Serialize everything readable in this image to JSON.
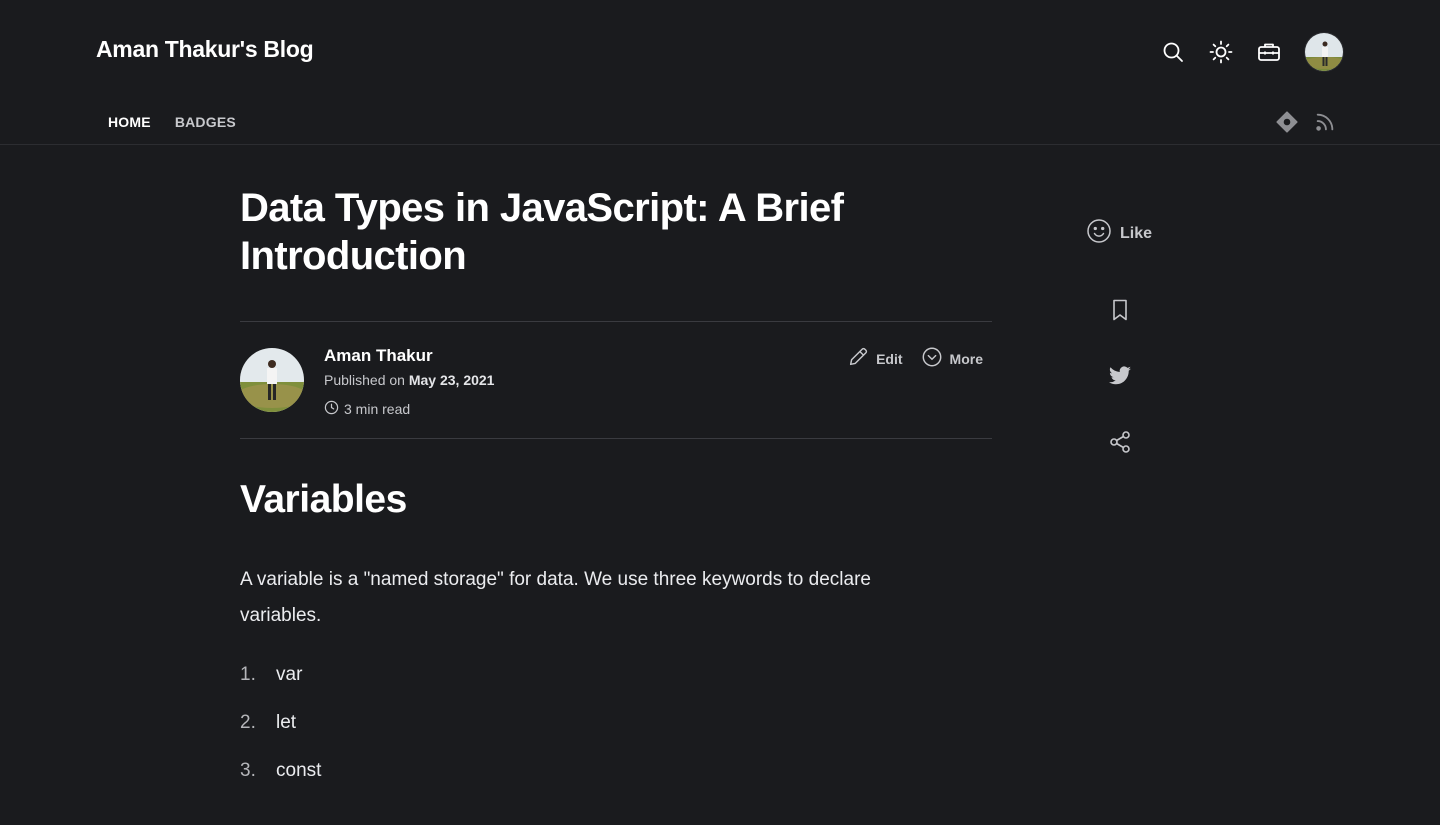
{
  "header": {
    "blog_title": "Aman Thakur's Blog",
    "icons": [
      "search-icon",
      "sun-icon",
      "toolbox-icon",
      "avatar"
    ]
  },
  "nav": {
    "items": [
      {
        "label": "HOME",
        "active": true
      },
      {
        "label": "BADGES",
        "active": false
      }
    ],
    "right_icons": [
      "hashnode-icon",
      "rss-icon"
    ]
  },
  "article": {
    "title": "Data Types in JavaScript: A Brief Introduction",
    "author": {
      "name": "Aman Thakur",
      "published_prefix": "Published on",
      "published_date": "May 23, 2021",
      "read_time": "3 min read"
    },
    "actions": {
      "edit_label": "Edit",
      "more_label": "More"
    },
    "heading": "Variables",
    "paragraph": "A variable is a \"named storage\" for data. We use three keywords to declare variables.",
    "list": [
      {
        "num": "1.",
        "text": "var"
      },
      {
        "num": "2.",
        "text": "let"
      },
      {
        "num": "3.",
        "text": "const"
      }
    ]
  },
  "sidebar": {
    "like_label": "Like",
    "icons": [
      "smiley-icon",
      "bookmark-icon",
      "twitter-icon",
      "share-icon"
    ]
  },
  "colors": {
    "background": "#1a1b1e",
    "text": "#ffffff",
    "muted": "#c7c8cc",
    "divider": "#3a3b40"
  }
}
